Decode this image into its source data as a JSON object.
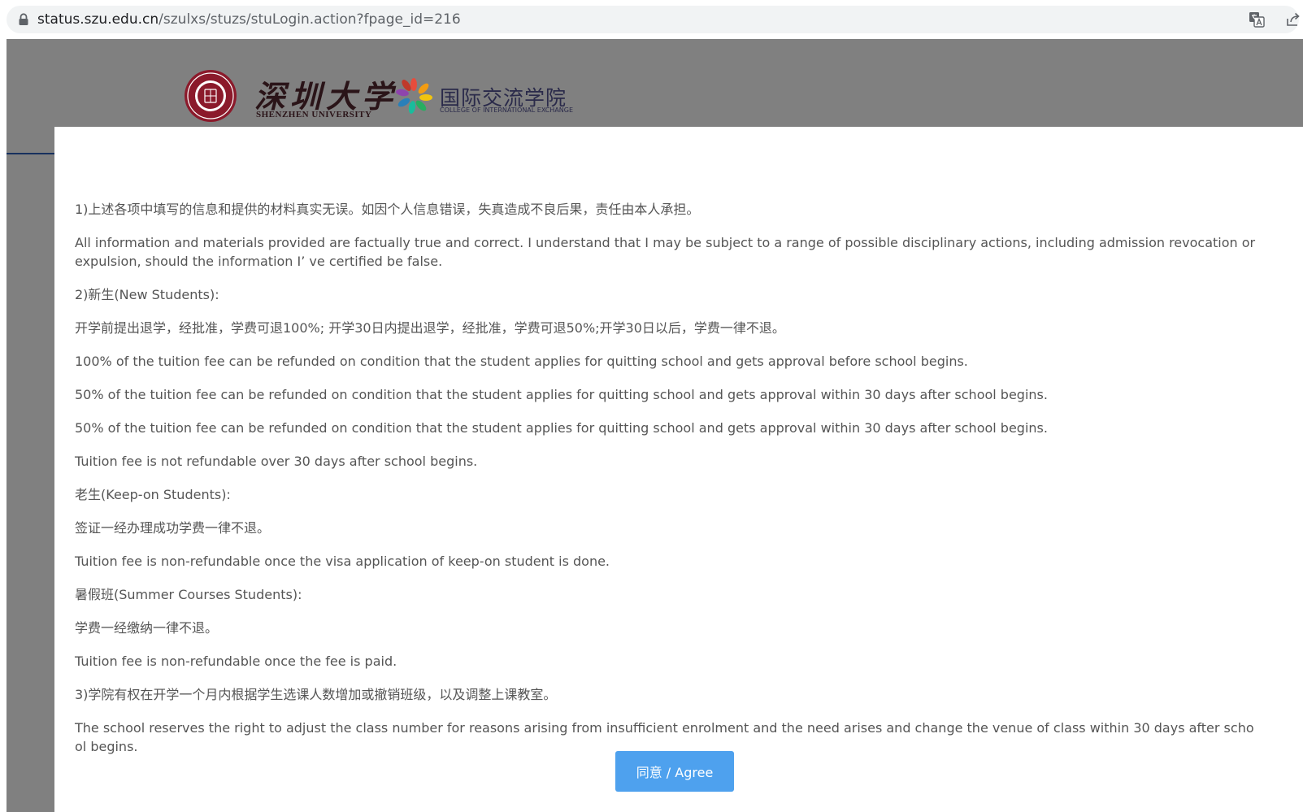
{
  "browser": {
    "url_host": "status.szu.edu.cn",
    "url_path": "/szulxs/stuzs/stuLogin.action?fpage_id=216"
  },
  "header": {
    "szu_name_cn": "深圳大学",
    "szu_name_en": "SHENZHEN UNIVERSITY",
    "college_name_cn": "国际交流学院",
    "college_name_en": "COLLEGE OF INTERNATIONAL EXCHANGE"
  },
  "terms": {
    "paragraphs": [
      "1)上述各项中填写的信息和提供的材料真实无误。如因个人信息错误，失真造成不良后果，责任由本人承担。",
      "All information and materials provided are factually true and correct. I understand that I may be subject to a range of possible disciplinary actions, including admission revocation or expulsion, should the information I’ ve certified be false.",
      "2)新生(New Students):",
      "开学前提出退学，经批准，学费可退100%; 开学30日内提出退学，经批准，学费可退50%;开学30日以后，学费一律不退。",
      "100% of the tuition fee can be refunded on condition that the student applies for quitting school and gets approval before school begins.",
      "50% of the tuition fee can be refunded on condition that the student applies for quitting school and gets approval within 30 days after school begins.",
      "50% of the tuition fee can be refunded on condition that the student applies for quitting school and gets approval within 30 days after school begins.",
      "Tuition fee is not refundable over 30 days after school begins.",
      "老生(Keep-on Students):",
      "签证一经办理成功学费一律不退。",
      "Tuition fee is non-refundable once the visa application of keep-on student is done.",
      "暑假班(Summer Courses Students):",
      "学费一经缴纳一律不退。",
      "Tuition fee is non-refundable once the fee is paid.",
      "3)学院有权在开学一个月内根据学生选课人数增加或撤销班级，以及调整上课教室。",
      "The school reserves the right to adjust the class number for reasons arising from insufficient enrolment and the need arises and change the venue of class within 30 days after school begins."
    ],
    "agree_label": "同意 / Agree"
  },
  "colors": {
    "overlay": "#808080",
    "button": "#4ea1ee",
    "text": "#555555",
    "seal": "#8b1a2b"
  },
  "icons": {
    "lock": "lock-icon",
    "translate": "translate-icon",
    "share": "share-icon"
  }
}
